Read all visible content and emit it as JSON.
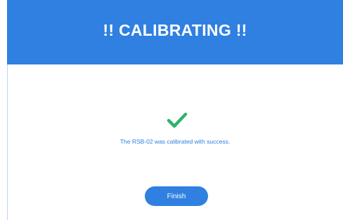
{
  "dialog": {
    "title": "!! CALIBRATING !!",
    "message": "The RSB-02 was calibrated with success.",
    "finish_label": "Finish",
    "status_icon": "checkmark-icon"
  },
  "colors": {
    "header_bg": "#2f80e0",
    "accent": "#2f80e0",
    "success": "#2fb36b",
    "background": "#ffffff"
  }
}
